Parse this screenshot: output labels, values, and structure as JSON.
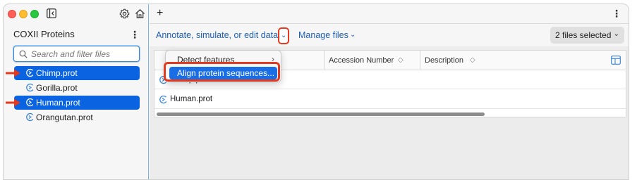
{
  "sidebar": {
    "project_title": "COXII Proteins",
    "project_menu_glyph": "⋮",
    "search_placeholder": "Search and filter files",
    "files": [
      {
        "label": "Chimp.prot",
        "selected": true,
        "arrow": true
      },
      {
        "label": "Gorilla.prot",
        "selected": false,
        "arrow": false
      },
      {
        "label": "Human.prot",
        "selected": true,
        "arrow": true
      },
      {
        "label": "Orangutan.prot",
        "selected": false,
        "arrow": false
      }
    ]
  },
  "main": {
    "new_tab_glyph": "+",
    "menu_glyph": "⋮",
    "toolbar": {
      "annotate_label": "Annotate, simulate, or edit data",
      "annotate_chevron": "⌄",
      "manage_label": "Manage files",
      "manage_chevron": "⌄",
      "files_selected_label": "2 files selected",
      "files_selected_chevron": "⌄"
    },
    "table": {
      "columns": [
        {
          "label": "Accession Number",
          "sort": "◇"
        },
        {
          "label": "Description",
          "sort": "◇"
        }
      ],
      "rows": [
        {
          "name": "Chimp.prot"
        },
        {
          "name": "Human.prot"
        }
      ]
    },
    "dropdown": {
      "items": [
        {
          "label": "Detect features",
          "submenu": "›",
          "highlighted": false
        },
        {
          "label": "Align protein sequences...",
          "submenu": "",
          "highlighted": true
        }
      ]
    }
  },
  "colors": {
    "selection_blue": "#0a63e0",
    "link_blue": "#1e5fb4",
    "annotation_red": "#e2391f"
  },
  "icons": {
    "sidebar_toggle": "sidebar-toggle-icon",
    "settings": "gear-icon",
    "home": "home-icon",
    "search": "search-icon",
    "file": "protein-file-icon",
    "columns": "columns-icon"
  }
}
